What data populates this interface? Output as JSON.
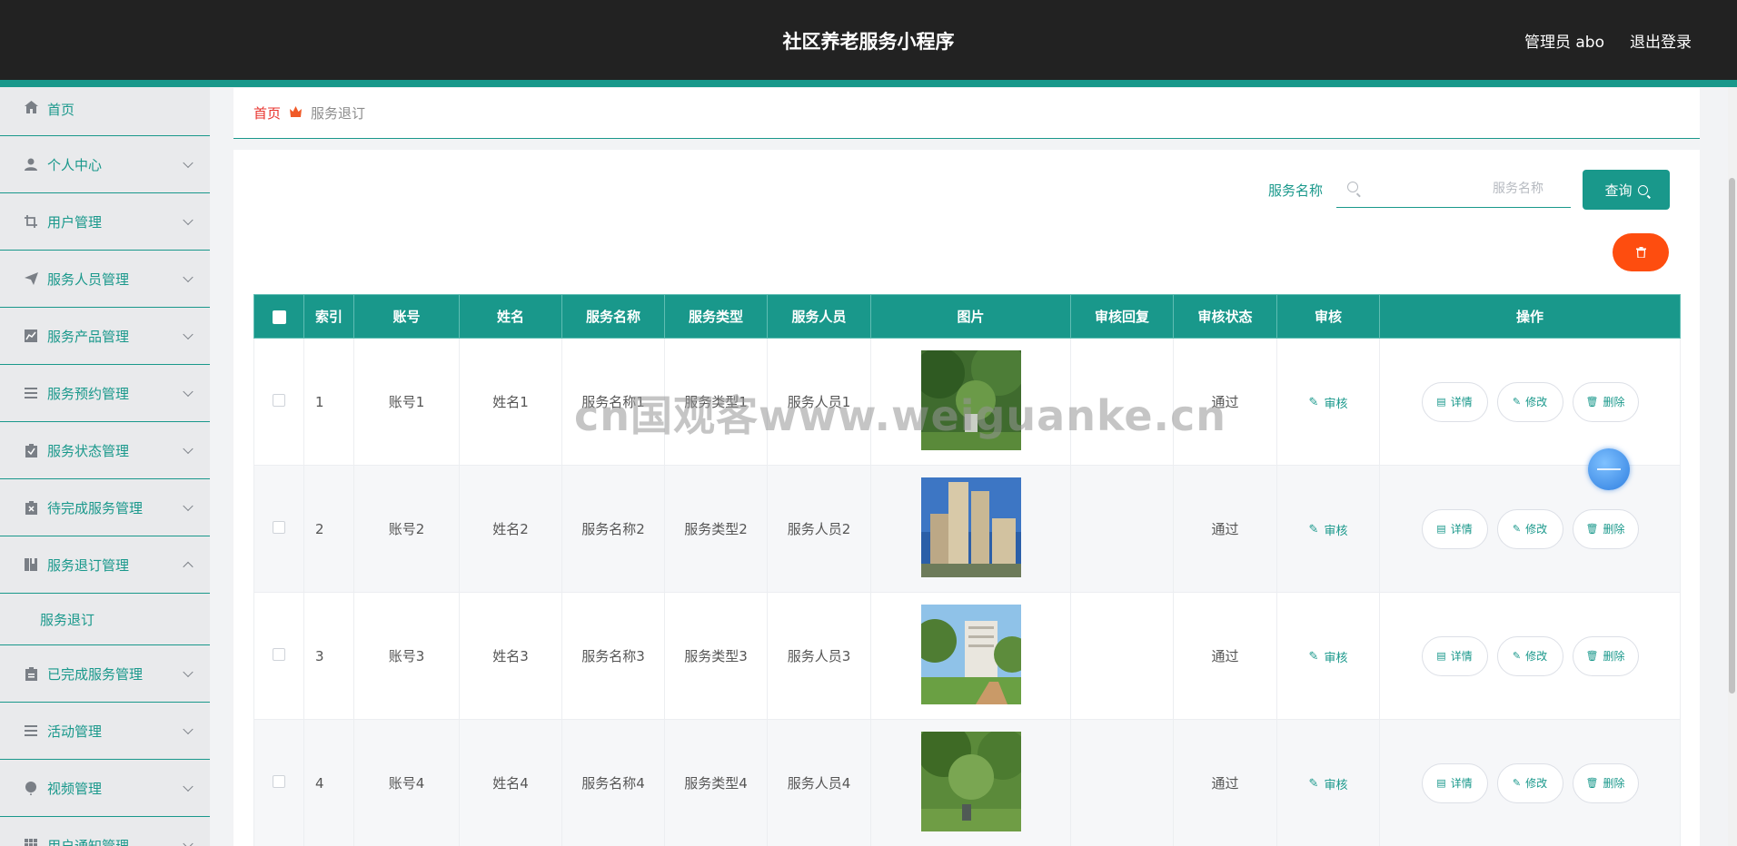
{
  "header": {
    "title": "社区养老服务小程序",
    "user": "管理员 abo",
    "logout": "退出登录"
  },
  "sidebar": {
    "items": [
      {
        "label": "首页",
        "icon": "home-icon",
        "expanded": null
      },
      {
        "label": "个人中心",
        "icon": "user-icon",
        "expanded": false
      },
      {
        "label": "用户管理",
        "icon": "crop-icon",
        "expanded": false
      },
      {
        "label": "服务人员管理",
        "icon": "send-icon",
        "expanded": false
      },
      {
        "label": "服务产品管理",
        "icon": "chart-icon",
        "expanded": false
      },
      {
        "label": "服务预约管理",
        "icon": "list-icon",
        "expanded": false
      },
      {
        "label": "服务状态管理",
        "icon": "clipboard-check-icon",
        "expanded": false
      },
      {
        "label": "待完成服务管理",
        "icon": "clipboard-x-icon",
        "expanded": false
      },
      {
        "label": "服务退订管理",
        "icon": "book-icon",
        "expanded": true,
        "sub": "服务退订"
      },
      {
        "label": "已完成服务管理",
        "icon": "clipboard-icon",
        "expanded": false
      },
      {
        "label": "活动管理",
        "icon": "list-icon",
        "expanded": false
      },
      {
        "label": "视频管理",
        "icon": "balloon-icon",
        "expanded": false
      },
      {
        "label": "用户通知管理",
        "icon": "grid-icon",
        "expanded": false
      }
    ]
  },
  "breadcrumb": {
    "home": "首页",
    "current": "服务退订"
  },
  "search": {
    "label": "服务名称",
    "placeholder": "服务名称",
    "button": "查询"
  },
  "table": {
    "headers": [
      "索引",
      "账号",
      "姓名",
      "服务名称",
      "服务类型",
      "服务人员",
      "图片",
      "审核回复",
      "审核状态",
      "审核",
      "操作"
    ],
    "rows": [
      {
        "index": "1",
        "account": "账号1",
        "name": "姓名1",
        "service_name": "服务名称1",
        "service_type": "服务类型1",
        "staff": "服务人员1",
        "reply": "",
        "status": "通过"
      },
      {
        "index": "2",
        "account": "账号2",
        "name": "姓名2",
        "service_name": "服务名称2",
        "service_type": "服务类型2",
        "staff": "服务人员2",
        "reply": "",
        "status": "通过"
      },
      {
        "index": "3",
        "account": "账号3",
        "name": "姓名3",
        "service_name": "服务名称3",
        "service_type": "服务类型3",
        "staff": "服务人员3",
        "reply": "",
        "status": "通过"
      },
      {
        "index": "4",
        "account": "账号4",
        "name": "姓名4",
        "service_name": "服务名称4",
        "service_type": "服务类型4",
        "staff": "服务人员4",
        "reply": "",
        "status": "通过"
      }
    ],
    "review_label": "审核",
    "actions": {
      "detail": "详情",
      "edit": "修改",
      "delete": "删除"
    }
  },
  "watermark": "cn国观客www.weiguanke.cn",
  "colors": {
    "primary": "#19988b",
    "header_bg": "#222222",
    "danger": "#fe4d0f",
    "breadcrumb_home": "#e8322c"
  }
}
